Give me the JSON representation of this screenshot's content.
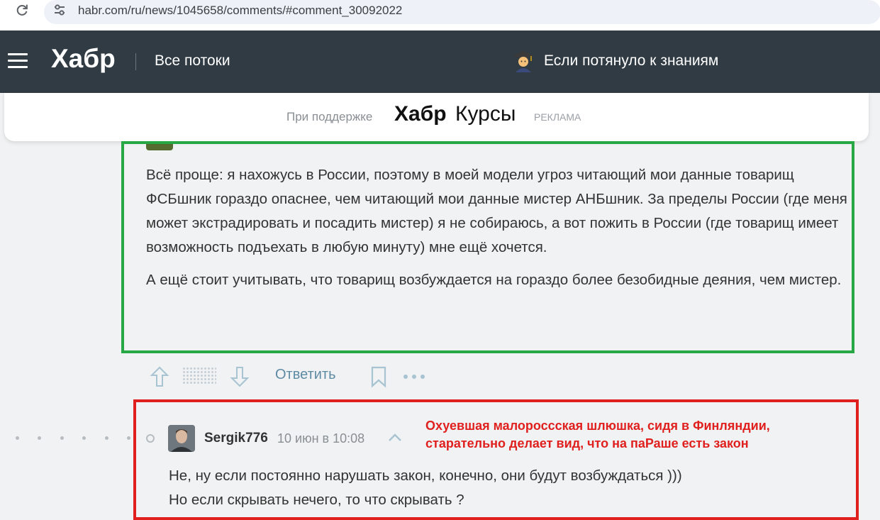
{
  "browser": {
    "url": "habr.com/ru/news/1045658/comments/#comment_30092022"
  },
  "header": {
    "logo": "Хабр",
    "nav_label": "Все потоки",
    "promo_text": "Если потянуло к знаниям",
    "promo_icon": "student-icon"
  },
  "sponsor": {
    "prefix": "При поддержке",
    "brand_bold": "Хабр",
    "brand_light": "Курсы",
    "ad_label": "РЕКЛАМА"
  },
  "comment1": {
    "paragraph1": "Всё проще: я нахожусь в России, поэтому в моей модели угроз читающий мои данные товарищ ФСБшник гораздо опаснее, чем читающий мои данные мистер АНБшник. За пределы России (где меня может экстрадировать и посадить мистер) я не собираюсь, а вот пожить в России (где товарищ имеет возможность подъехать в любую минуту) мне ещё хочется.",
    "paragraph2": "А ещё стоит учитывать, что товарищ возбуждается на гораздо более безобидные деяния, чем мистер.",
    "highlight_color": "#28a745"
  },
  "actions": {
    "reply_label": "Ответить"
  },
  "comment2": {
    "username": "Sergik776",
    "time": "10 июн в 10:08",
    "annotation_line1": "Охуевшая малороссская шлюшка, сидя в Финляндии,",
    "annotation_line2": "старательно делает вид, что на паРаше есть закон",
    "line1": "Не, ну если постоянно нарушать закон, конечно, они будут возбуждаться )))",
    "line2": "Но если скрывать нечего, то что скрывать ?",
    "highlight_color": "#e0201e"
  }
}
